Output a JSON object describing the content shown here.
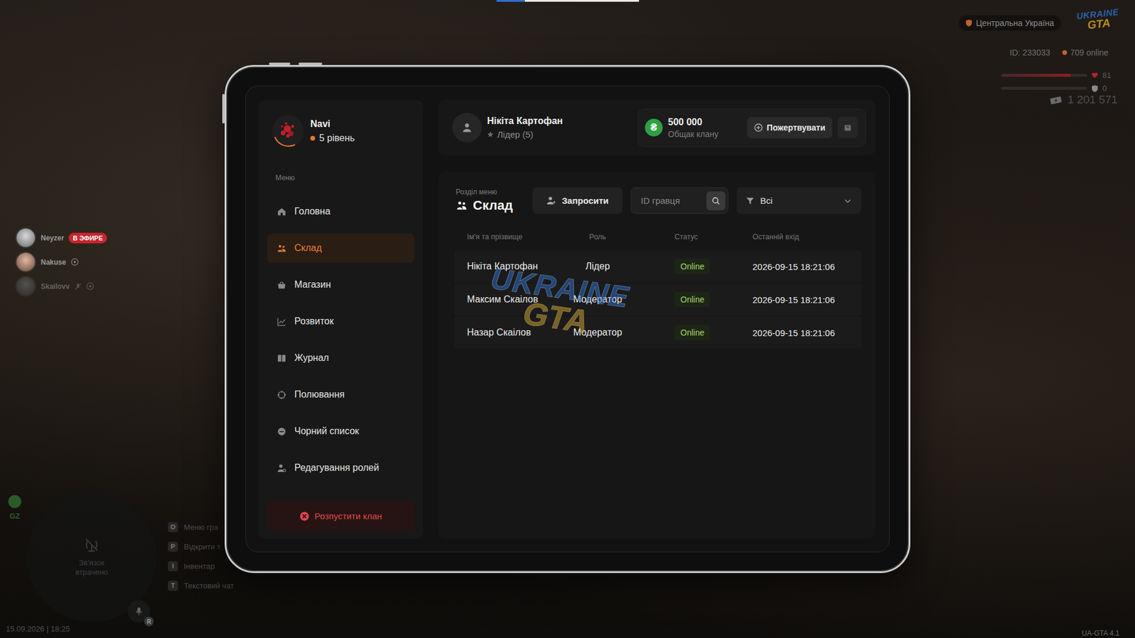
{
  "top_progress": {
    "level": 0.2
  },
  "hud": {
    "region": "Центральна Україна",
    "logo": {
      "top": "UKRAINE",
      "bottom": "GTA"
    },
    "player_id": "ID: 233033",
    "online": "709 online",
    "health": {
      "value": "81",
      "level": 0.81
    },
    "armor": {
      "value": "0",
      "level": 0
    },
    "money": "1 201 571",
    "voice": [
      {
        "name": "Neyzer",
        "badge": "В ЭФИРЕ",
        "live": true,
        "muted": false
      },
      {
        "name": "Nakuse",
        "badge": "",
        "live": false,
        "muted": false
      },
      {
        "name": "Skailovv",
        "badge": "",
        "live": false,
        "muted": true
      }
    ],
    "zone": "GZ",
    "radio": "Зв'язок втрачено",
    "mic_key": "R",
    "hints": [
      {
        "key": "O",
        "label": "Меню гра"
      },
      {
        "key": "P",
        "label": "Відкрити т"
      },
      {
        "key": "I",
        "label": "Інвентар"
      },
      {
        "key": "T",
        "label": "Текстовий чат"
      }
    ],
    "datetime": "15.09.2026 | 18:25",
    "version": "UA-GTA 4.1"
  },
  "clan": {
    "name": "Navi",
    "level": "5 рівень"
  },
  "menu": {
    "label": "Меню",
    "items": [
      {
        "label": "Головна",
        "selected": false
      },
      {
        "label": "Склад",
        "selected": true
      },
      {
        "label": "Магазин",
        "selected": false
      },
      {
        "label": "Розвиток",
        "selected": false
      },
      {
        "label": "Журнал",
        "selected": false
      },
      {
        "label": "Полювання",
        "selected": false
      },
      {
        "label": "Чорний список",
        "selected": false
      },
      {
        "label": "Редагування ролей",
        "selected": false
      }
    ]
  },
  "disband_button": "Розпустити клан",
  "user": {
    "name": "Нікіта Картофан",
    "role": "Лідер (5)"
  },
  "balance": {
    "currency": "₴",
    "amount": "500 000",
    "label": "Общак клану"
  },
  "donate_button": "Пожертвувати",
  "section": {
    "caption": "Розділ меню",
    "title": "Склад"
  },
  "invite_button": "Запросити",
  "search": {
    "placeholder": "ID гравця"
  },
  "filter": {
    "value": "Всі"
  },
  "table": {
    "columns": [
      "Ім'я та прізвище",
      "Роль",
      "Статус",
      "Останній вхід"
    ],
    "rows": [
      {
        "name": "Нікіта Картофан",
        "role": "Лідер",
        "status": "Online",
        "online": true,
        "last_login": "2026-09-15 18:21:06"
      },
      {
        "name": "Максим Скаілов",
        "role": "Модератор",
        "status": "Online",
        "online": true,
        "last_login": "2026-09-15 18:21:06"
      },
      {
        "name": "Назар Скаілов",
        "role": "Модератор",
        "status": "Online",
        "online": true,
        "last_login": "2026-09-15 18:21:06"
      }
    ],
    "watermark": {
      "top": "UKRAINE",
      "bottom": "GTA"
    }
  }
}
